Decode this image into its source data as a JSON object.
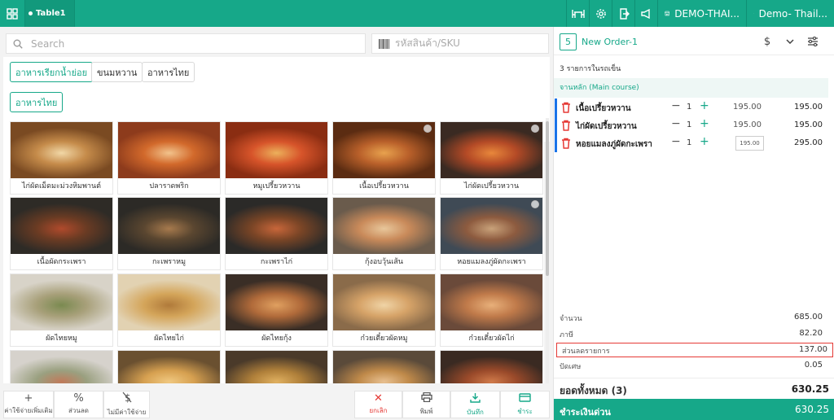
{
  "topbar": {
    "table_tab": "Table1",
    "store_label": "DEMO-THAI...",
    "user_label": "Demo- Thail..."
  },
  "search": {
    "placeholder": "Search"
  },
  "sku": {
    "placeholder": "รหัสสินค้า/SKU"
  },
  "categories": [
    "อาหารเรียกน้ำย่อย",
    "ขนมหวาน",
    "อาหารไทย",
    "อาหารไทย"
  ],
  "products": [
    "ไก่ผัดเม็ดมะม่วงหิมพานต์",
    "ปลาราดพริก",
    "หมูเปรี้ยวหวาน",
    "เนื้อเปรี้ยวหวาน",
    "ไก่ผัดเปรี้ยวหวาน",
    "เนื้อผัดกระเพรา",
    "กะเพราหมู",
    "กะเพราไก่",
    "กุ้งอบวุ้นเส้น",
    "หอยแมลงภู่ผัดกะเพรา",
    "ผัดไทยหมู",
    "ผัดไทยไก่",
    "ผัดไทยกุ้ง",
    "ก๋วยเตี๋ยวผัดหมู",
    "ก๋วยเตี๋ยวผัดไก่",
    "",
    "",
    "",
    "",
    ""
  ],
  "bottom_buttons": [
    "ค่าใช้จ่ายเพิ่มเติม",
    "ส่วนลด",
    "ไม่มีค่าใช้จ่าย",
    "ยกเลิก",
    "พิมพ์",
    "บันทึก",
    "ชำระ"
  ],
  "order": {
    "number": "5",
    "name": "New Order-1",
    "item_count": "3 รายการในรถเข็น",
    "course": "จานหลัก (Main course)",
    "lines": [
      {
        "name": "เนื้อเปรี้ยวหวาน",
        "qty": "1",
        "price": "195.00",
        "total": "195.00"
      },
      {
        "name": "ไก่ผัดเปรี้ยวหวาน",
        "qty": "1",
        "price": "195.00",
        "total": "195.00"
      },
      {
        "name": "หอยแมลงภู่ผัดกะเพรา",
        "qty": "1",
        "price": "",
        "total": "295.00"
      }
    ],
    "price_edit_value": "195.00",
    "summary": [
      {
        "label": "จำนวน",
        "value": "685.00"
      },
      {
        "label": "ภาษี",
        "value": "82.20"
      },
      {
        "label": "ส่วนลดรายการ",
        "value": "137.00"
      },
      {
        "label": "ปัดเศษ",
        "value": "0.05"
      }
    ],
    "grand_label": "ยอดทั้งหมด  (3)",
    "grand_value": "630.25",
    "pay_label": "ชำระเงินด่วน",
    "pay_value": "630.25"
  },
  "colors": {
    "accent": "#16a889",
    "danger": "#e53935",
    "line_bar": "#1a73e8"
  }
}
